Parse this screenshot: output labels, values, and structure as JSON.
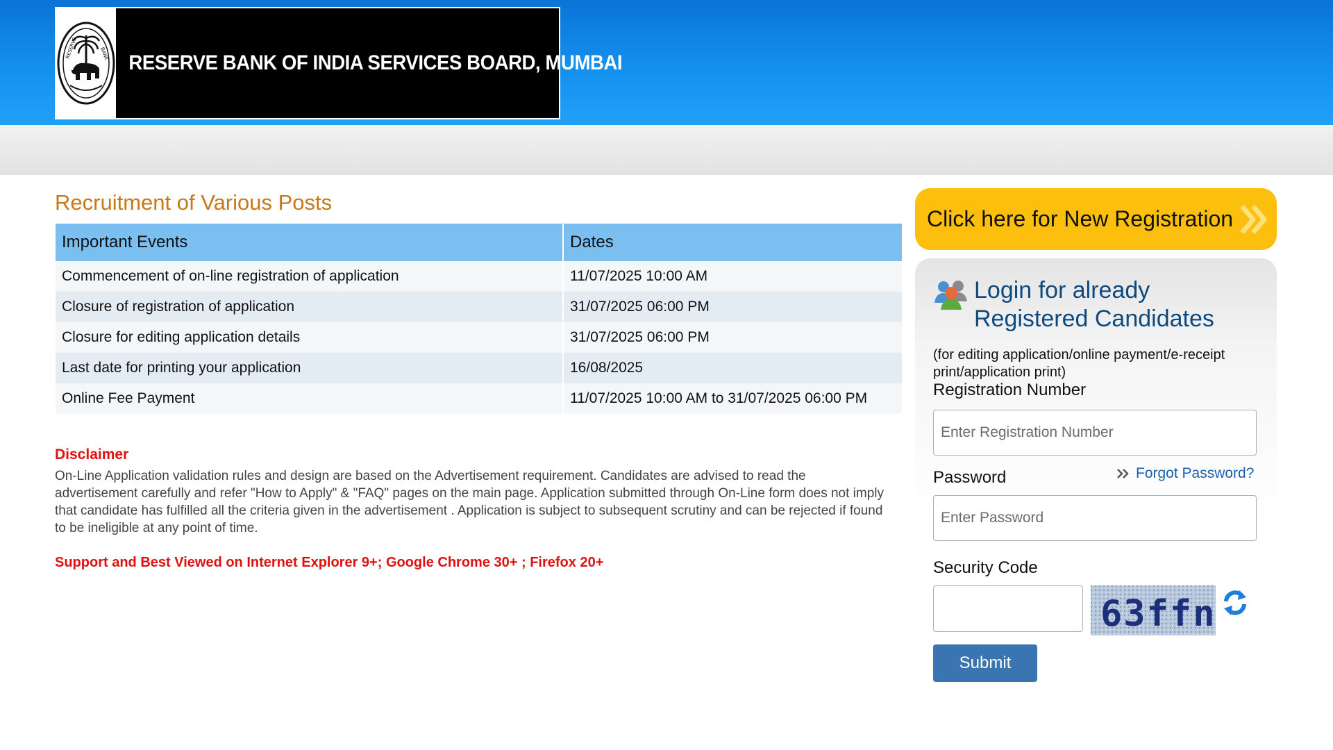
{
  "header": {
    "title": "RESERVE BANK OF INDIA SERVICES BOARD, MUMBAI",
    "logo_icon": "rbi-emblem-icon"
  },
  "main": {
    "heading": "Recruitment of Various Posts",
    "table": {
      "headers": [
        "Important Events",
        "Dates"
      ],
      "rows": [
        [
          "Commencement of on-line registration of application",
          "11/07/2025 10:00 AM"
        ],
        [
          "Closure of registration of application",
          "31/07/2025 06:00 PM"
        ],
        [
          "Closure for editing application details",
          "31/07/2025 06:00 PM"
        ],
        [
          "Last date for printing your application",
          "16/08/2025"
        ],
        [
          "Online Fee Payment",
          "11/07/2025 10:00 AM to 31/07/2025 06:00 PM"
        ]
      ]
    },
    "disclaimer_title": "Disclaimer",
    "disclaimer_text": "On-Line Application validation rules and design are based on the Advertisement requirement. Candidates are advised to read the advertisement carefully and refer \"How to Apply\" & \"FAQ\" pages on the main page. Application submitted through On-Line form does not imply that candidate has fulfilled all the criteria given in the advertisement . Application is subject to subsequent scrutiny and can be rejected if found to be ineligible at any point of time.",
    "support_text": "Support and Best Viewed on Internet Explorer 9+; Google Chrome 30+ ; Firefox 20+"
  },
  "sidebar": {
    "new_registration_label": "Click here for New Registration",
    "login": {
      "title": "Login for already Registered Candidates",
      "note": "(for editing application/online payment/e-receipt print/application print)",
      "registration_label": "Registration Number",
      "registration_placeholder": "Enter Registration Number",
      "registration_value": "",
      "password_label": "Password",
      "password_placeholder": "Enter Password",
      "password_value": "",
      "forgot_label": "Forgot Password?",
      "security_label": "Security Code",
      "security_value": "",
      "captcha_text": "63ffn",
      "submit_label": "Submit"
    }
  },
  "colors": {
    "header_blue": "#1592f0",
    "heading_orange": "#c7781a",
    "table_header": "#7bbef0",
    "alert_red": "#e01010",
    "registration_yellow": "#fdbf0d",
    "login_title_blue": "#0d4a80",
    "link_blue": "#1860b0",
    "submit_blue": "#3a75b2"
  }
}
